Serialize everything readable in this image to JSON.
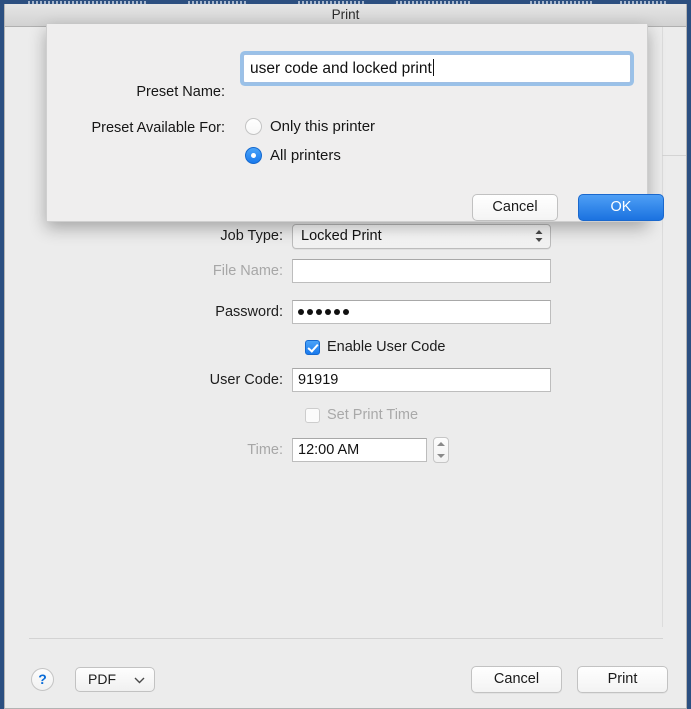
{
  "background": {
    "behind_window_note": "blue-menu-strip"
  },
  "window": {
    "title": "Print"
  },
  "sheet": {
    "preset_name_label": "Preset Name:",
    "preset_name_value": "user code and locked print",
    "preset_available_label": "Preset Available For:",
    "radio_options": [
      {
        "label": "Only this printer",
        "selected": false
      },
      {
        "label": "All printers",
        "selected": true
      }
    ],
    "cancel_label": "Cancel",
    "ok_label": "OK"
  },
  "settings": {
    "job_type": {
      "label": "Job Type:",
      "value": "Locked Print",
      "enabled": true
    },
    "file_name": {
      "label": "File Name:",
      "value": "",
      "enabled": false
    },
    "password": {
      "label": "Password:",
      "value": "••••••",
      "dot_count": 6,
      "enabled": true
    },
    "enable_user_code": {
      "label": "Enable User Code",
      "checked": true
    },
    "user_code": {
      "label": "User Code:",
      "value": "91919",
      "enabled": true
    },
    "set_print_time": {
      "label": "Set Print Time",
      "checked": false,
      "enabled": false
    },
    "time": {
      "label": "Time:",
      "value": "12:00 AM",
      "enabled": false
    }
  },
  "bottom_bar": {
    "help_label": "?",
    "pdf_label": "PDF",
    "cancel_label": "Cancel",
    "print_label": "Print"
  },
  "colors": {
    "accent_blue": "#1a7aed",
    "window_bg": "#ececec",
    "sheet_bg": "#efeeee",
    "focus_ring": "#7eb1e6"
  }
}
